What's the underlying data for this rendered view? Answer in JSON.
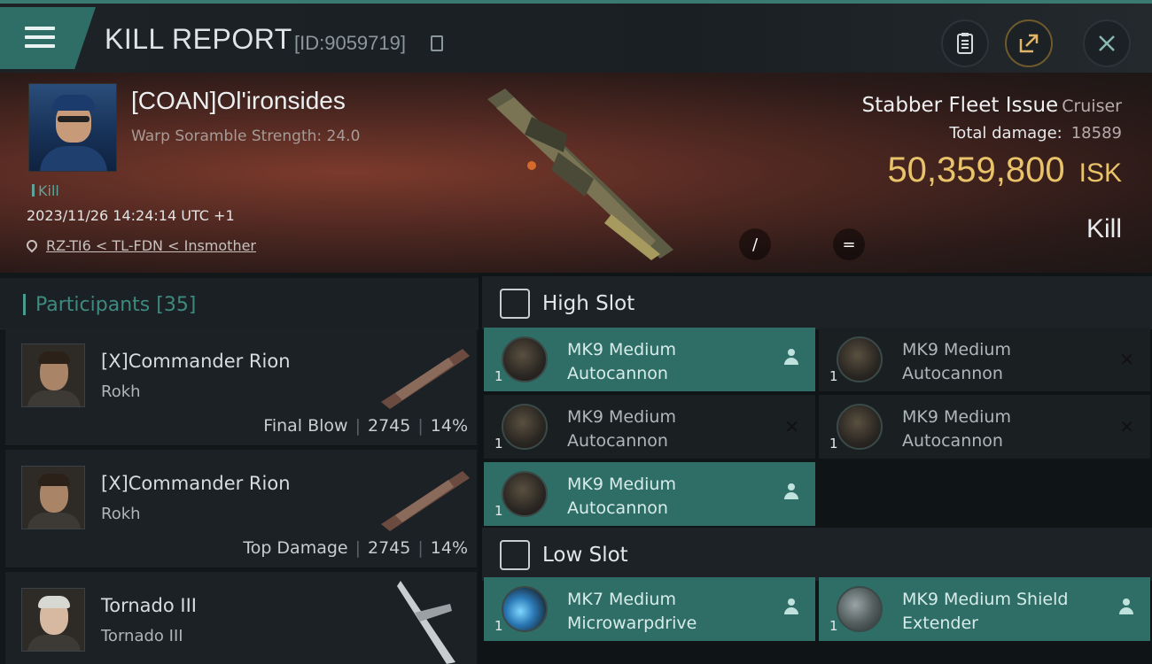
{
  "header": {
    "title": "KILL REPORT",
    "kill_id": "[ID:9059719]",
    "icons": [
      "menu-icon",
      "clipboard-icon",
      "share-icon",
      "close-icon"
    ]
  },
  "victim": {
    "name": "[COAN]Ol'ironsides",
    "warp_scramble": "Warp Soramble Strength: 24.0",
    "tag": "Kill",
    "datetime": "2023/11/26 14:24:14 UTC +1",
    "location": "RZ-TI6 < TL-FDN < Insmother",
    "ship_name": "Stabber Fleet Issue",
    "ship_class": "Cruiser",
    "total_damage_label": "Total damage:",
    "total_damage": "18589",
    "isk_value": "50,359,800",
    "isk_unit": "ISK",
    "result": "Kill",
    "toggle_a": "/",
    "toggle_b": "="
  },
  "participants": {
    "label": "Participants",
    "count": "[35]",
    "rows": [
      {
        "name": "[X]Commander Rion",
        "ship": "Rokh",
        "role": "Final Blow",
        "damage": "2745",
        "percent": "14%"
      },
      {
        "name": "[X]Commander Rion",
        "ship": "Rokh",
        "role": "Top Damage",
        "damage": "2745",
        "percent": "14%"
      },
      {
        "name": "Tornado III",
        "ship": "Tornado III",
        "role": "",
        "damage": "",
        "percent": ""
      }
    ]
  },
  "slots": {
    "high_label": "High Slot",
    "low_label": "Low Slot",
    "high": [
      {
        "line1": "MK9 Medium",
        "line2": "Autocannon",
        "qty": "1",
        "state": "fitted"
      },
      {
        "line1": "MK9 Medium",
        "line2": "Autocannon",
        "qty": "1",
        "state": "destroyed"
      },
      {
        "line1": "MK9 Medium",
        "line2": "Autocannon",
        "qty": "1",
        "state": "destroyed"
      },
      {
        "line1": "MK9 Medium",
        "line2": "Autocannon",
        "qty": "1",
        "state": "destroyed"
      },
      {
        "line1": "MK9 Medium",
        "line2": "Autocannon",
        "qty": "1",
        "state": "fitted"
      }
    ],
    "low": [
      {
        "line1": "MK7 Medium",
        "line2": "Microwarpdrive",
        "qty": "1",
        "state": "fitted"
      },
      {
        "line1": "MK9 Medium Shield",
        "line2": "Extender",
        "qty": "1",
        "state": "fitted"
      }
    ]
  },
  "colors": {
    "accent_teal": "#2f6e66",
    "isk_gold": "#e9c36a",
    "participants_label": "#3f8a80"
  }
}
